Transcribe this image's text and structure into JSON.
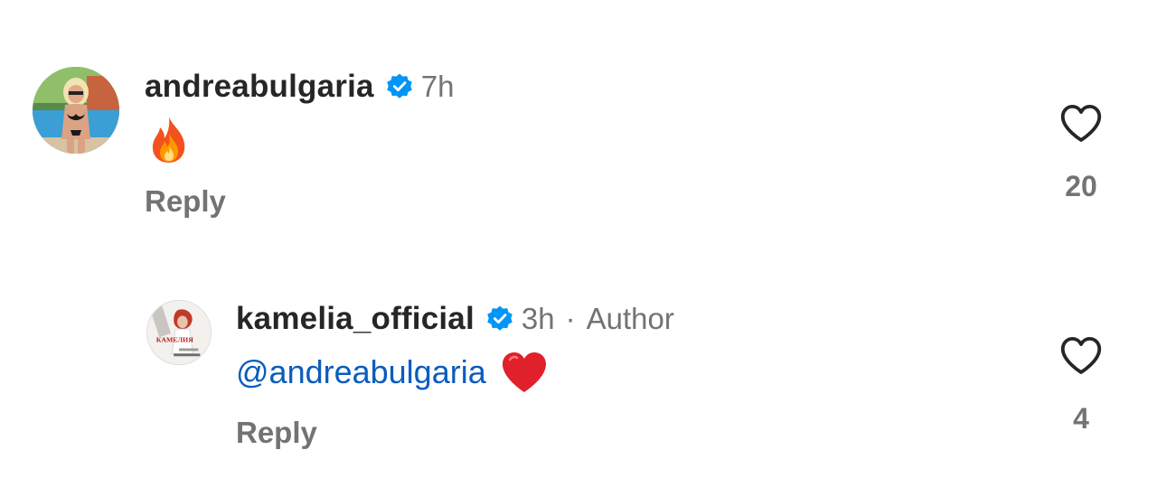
{
  "comments": [
    {
      "username": "andreabulgaria",
      "verified": true,
      "time": "7h",
      "emoji": "fire-emoji",
      "reply_label": "Reply",
      "likes": "20",
      "avatar": "beach-photo-avatar"
    },
    {
      "username": "kamelia_official",
      "verified": true,
      "time": "3h",
      "separator": "·",
      "author_label": "Author",
      "mention": "@andreabulgaria",
      "emoji": "red-heart-emoji",
      "reply_label": "Reply",
      "likes": "4",
      "avatar": "album-cover-avatar",
      "avatar_text": "КАМЕЛИЯ"
    }
  ],
  "colors": {
    "username": "#262626",
    "secondary": "#737373",
    "mention": "#0a5cbd",
    "verified": "#0095f6",
    "heart_outline": "#262626"
  },
  "icons": {
    "verified": "verified-badge-icon",
    "like": "heart-outline-icon"
  }
}
